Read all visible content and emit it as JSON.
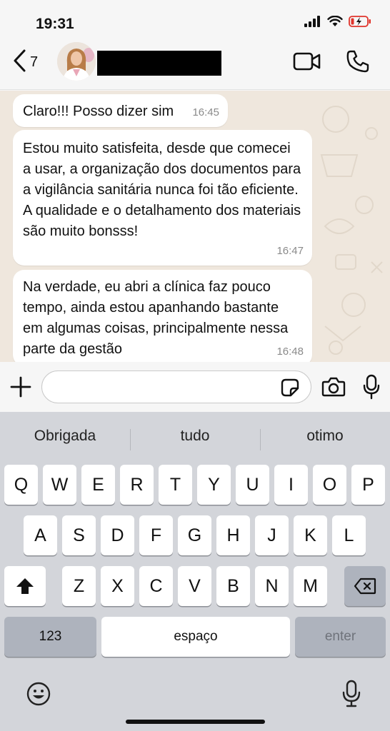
{
  "status_bar": {
    "time": "19:31"
  },
  "header": {
    "back_count": "7"
  },
  "messages": [
    {
      "text": "Claro!!! Posso dizer sim",
      "time": "16:45"
    },
    {
      "text": "Estou muito satisfeita, desde que comecei a usar, a organização dos documentos para a vigilância sanitária nunca foi tão eficiente. A qualidade e o detalhamento dos materiais são muito bonsss!",
      "time": "16:47"
    },
    {
      "text": "Na verdade, eu abri a clínica faz pouco tempo, ainda estou apanhando bastante em algumas coisas, principalmente nessa parte da gestão",
      "time": "16:48"
    }
  ],
  "composer": {
    "value": "",
    "placeholder": ""
  },
  "suggestions": [
    "Obrigada",
    "tudo",
    "otimo"
  ],
  "keyboard": {
    "row1": [
      "Q",
      "W",
      "E",
      "R",
      "T",
      "Y",
      "U",
      "I",
      "O",
      "P"
    ],
    "row2": [
      "A",
      "S",
      "D",
      "F",
      "G",
      "H",
      "J",
      "K",
      "L"
    ],
    "row3": [
      "Z",
      "X",
      "C",
      "V",
      "B",
      "N",
      "M"
    ],
    "numbers_label": "123",
    "space_label": "espaço",
    "enter_label": "enter"
  },
  "icons": {
    "back": "chevron-left-icon",
    "video": "video-camera-icon",
    "call": "phone-icon",
    "plus": "plus-icon",
    "sticker": "sticker-icon",
    "camera": "camera-icon",
    "mic": "microphone-icon",
    "shift": "shift-icon",
    "backspace": "backspace-icon",
    "emoji": "emoji-icon",
    "dictation": "dictation-icon"
  },
  "colors": {
    "chat_background": "#efe7dd",
    "bubble": "#ffffff",
    "keyboard": "#d3d5da",
    "battery_low": "#e0342b"
  }
}
